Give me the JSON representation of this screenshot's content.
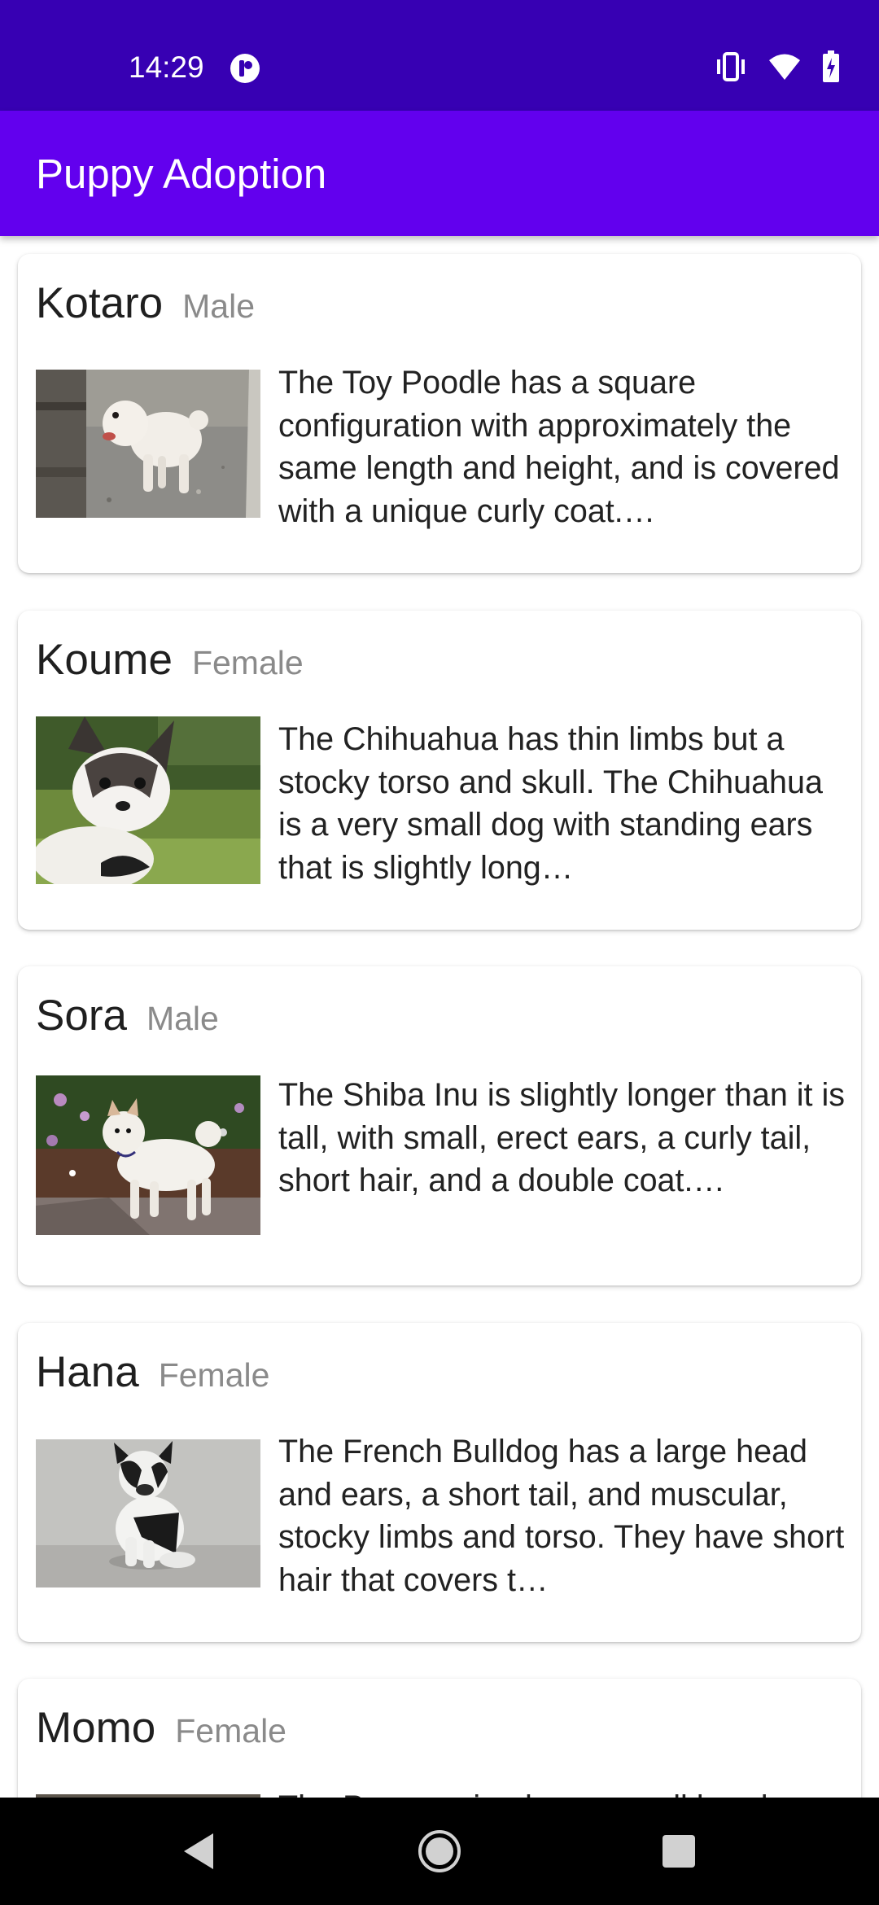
{
  "status_bar": {
    "time": "14:29",
    "icons": [
      "app-notification-icon",
      "vibrate-icon",
      "wifi-icon",
      "battery-charging-icon"
    ]
  },
  "app_bar": {
    "title": "Puppy Adoption"
  },
  "puppies": [
    {
      "name": "Kotaro",
      "gender": "Male",
      "description": "The Toy Poodle has a square configuration with approximately the same length and height, and is covered with a unique curly coat.…",
      "photo": "toy-poodle-photo"
    },
    {
      "name": "Koume",
      "gender": "Female",
      "description": "The Chihuahua has thin limbs but a stocky torso and skull. The Chihuahua is a very small dog with standing ears that is slightly long…",
      "photo": "chihuahua-photo"
    },
    {
      "name": "Sora",
      "gender": "Male",
      "description": "The Shiba Inu is slightly longer than it is tall, with small, erect ears, a curly tail, short hair, and a double coat.…",
      "photo": "shiba-inu-photo"
    },
    {
      "name": "Hana",
      "gender": "Female",
      "description": "The French Bulldog has a large head and ears, a short tail, and muscular, stocky limbs and torso. They have short hair that covers t…",
      "photo": "french-bulldog-photo"
    },
    {
      "name": "Momo",
      "gender": "Female",
      "description": "The Pomeranian has a small head…",
      "photo": "pomeranian-photo"
    }
  ],
  "nav_bar": {
    "buttons": [
      "back-icon",
      "home-icon",
      "recents-icon"
    ]
  }
}
